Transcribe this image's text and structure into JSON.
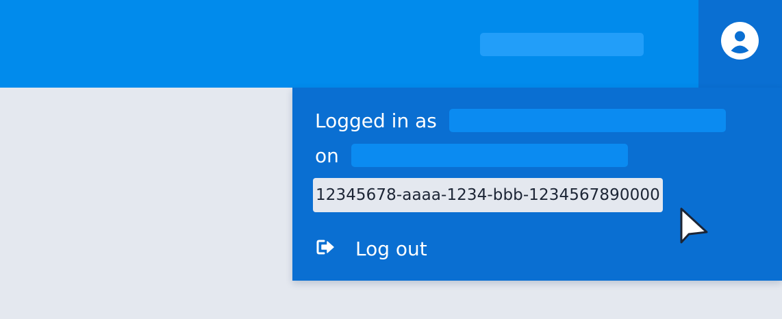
{
  "colors": {
    "header_bg": "#018bec",
    "dropdown_bg": "#0a6fd2",
    "page_bg": "#e4e8ef",
    "placeholder_bg": "#0b8bf1"
  },
  "account_menu": {
    "trigger_icon": "user-circle-icon",
    "logged_in_as_label": "Logged in as",
    "on_label": "on",
    "id_value": "12345678-aaaa-1234-bbb-1234567890000",
    "logout_label": "Log out",
    "logout_icon": "sign-out-icon"
  }
}
